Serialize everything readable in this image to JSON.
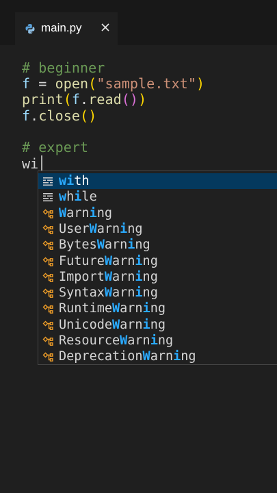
{
  "tab": {
    "title": "main.py",
    "file_icon": "python-icon",
    "close_icon": "close-icon"
  },
  "code": {
    "comment_beginner": "# beginner",
    "line_open": {
      "var": "f",
      "op": " = ",
      "fn": "open",
      "p1": "(",
      "str": "\"sample.txt\"",
      "p2": ")"
    },
    "line_print": {
      "fn": "print",
      "p1": "(",
      "obj": "f",
      "dot": ".",
      "method": "read",
      "p2": "(",
      "p3": ")",
      "p4": ")"
    },
    "line_close": {
      "obj": "f",
      "dot": ".",
      "method": "close",
      "p1": "(",
      "p2": ")"
    },
    "comment_expert": "# expert",
    "typed": "wi"
  },
  "suggestions": [
    {
      "label": "with",
      "kind": "keyword",
      "icon": "keyword-icon",
      "selected": true
    },
    {
      "label": "while",
      "kind": "keyword",
      "icon": "keyword-icon",
      "selected": false
    },
    {
      "label": "Warning",
      "kind": "class",
      "icon": "class-icon",
      "selected": false
    },
    {
      "label": "UserWarning",
      "kind": "class",
      "icon": "class-icon",
      "selected": false
    },
    {
      "label": "BytesWarning",
      "kind": "class",
      "icon": "class-icon",
      "selected": false
    },
    {
      "label": "FutureWarning",
      "kind": "class",
      "icon": "class-icon",
      "selected": false
    },
    {
      "label": "ImportWarning",
      "kind": "class",
      "icon": "class-icon",
      "selected": false
    },
    {
      "label": "SyntaxWarning",
      "kind": "class",
      "icon": "class-icon",
      "selected": false
    },
    {
      "label": "RuntimeWarning",
      "kind": "class",
      "icon": "class-icon",
      "selected": false
    },
    {
      "label": "UnicodeWarning",
      "kind": "class",
      "icon": "class-icon",
      "selected": false
    },
    {
      "label": "ResourceWarning",
      "kind": "class",
      "icon": "class-icon",
      "selected": false
    },
    {
      "label": "DeprecationWarning",
      "kind": "class",
      "icon": "class-icon",
      "selected": false
    }
  ],
  "colors": {
    "background": "#1f1f1f",
    "selection": "#04395e",
    "match_highlight": "#2aaaff",
    "class_icon": "#ee9d28",
    "keyword_icon": "#cccccc"
  }
}
